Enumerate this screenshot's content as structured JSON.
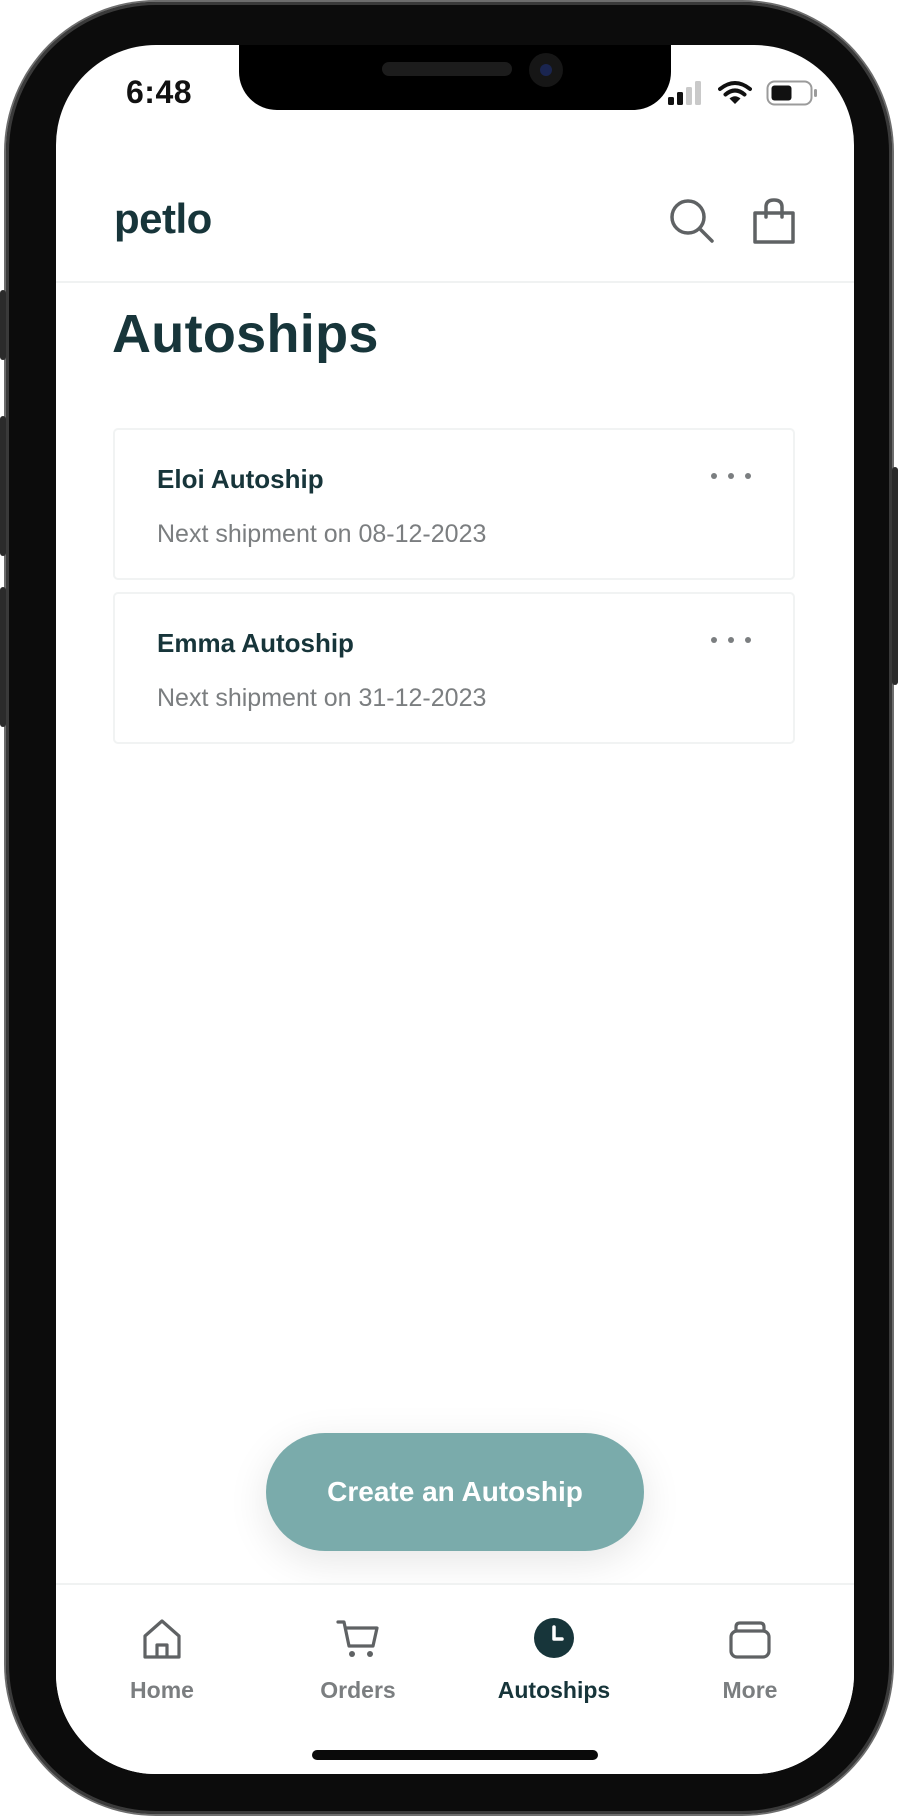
{
  "status_bar": {
    "time": "6:48"
  },
  "header": {
    "logo": "petlo",
    "search_icon": "search-icon",
    "cart_icon": "shopping-bag-icon"
  },
  "page": {
    "title": "Autoships"
  },
  "autoships": [
    {
      "name": "Eloi Autoship",
      "next_shipment": "Next shipment on 08-12-2023"
    },
    {
      "name": "Emma Autoship",
      "next_shipment": "Next shipment on 31-12-2023"
    }
  ],
  "cta": {
    "label": "Create an Autoship"
  },
  "tabbar": {
    "items": [
      {
        "label": "Home",
        "icon": "home-icon"
      },
      {
        "label": "Orders",
        "icon": "cart-icon"
      },
      {
        "label": "Autoships",
        "icon": "clock-icon",
        "active": true
      },
      {
        "label": "More",
        "icon": "stack-icon"
      }
    ]
  },
  "colors": {
    "brand_dark": "#17353a",
    "accent": "#7aabab",
    "muted_text": "#7b7e80",
    "divider": "#f0f2f2"
  }
}
